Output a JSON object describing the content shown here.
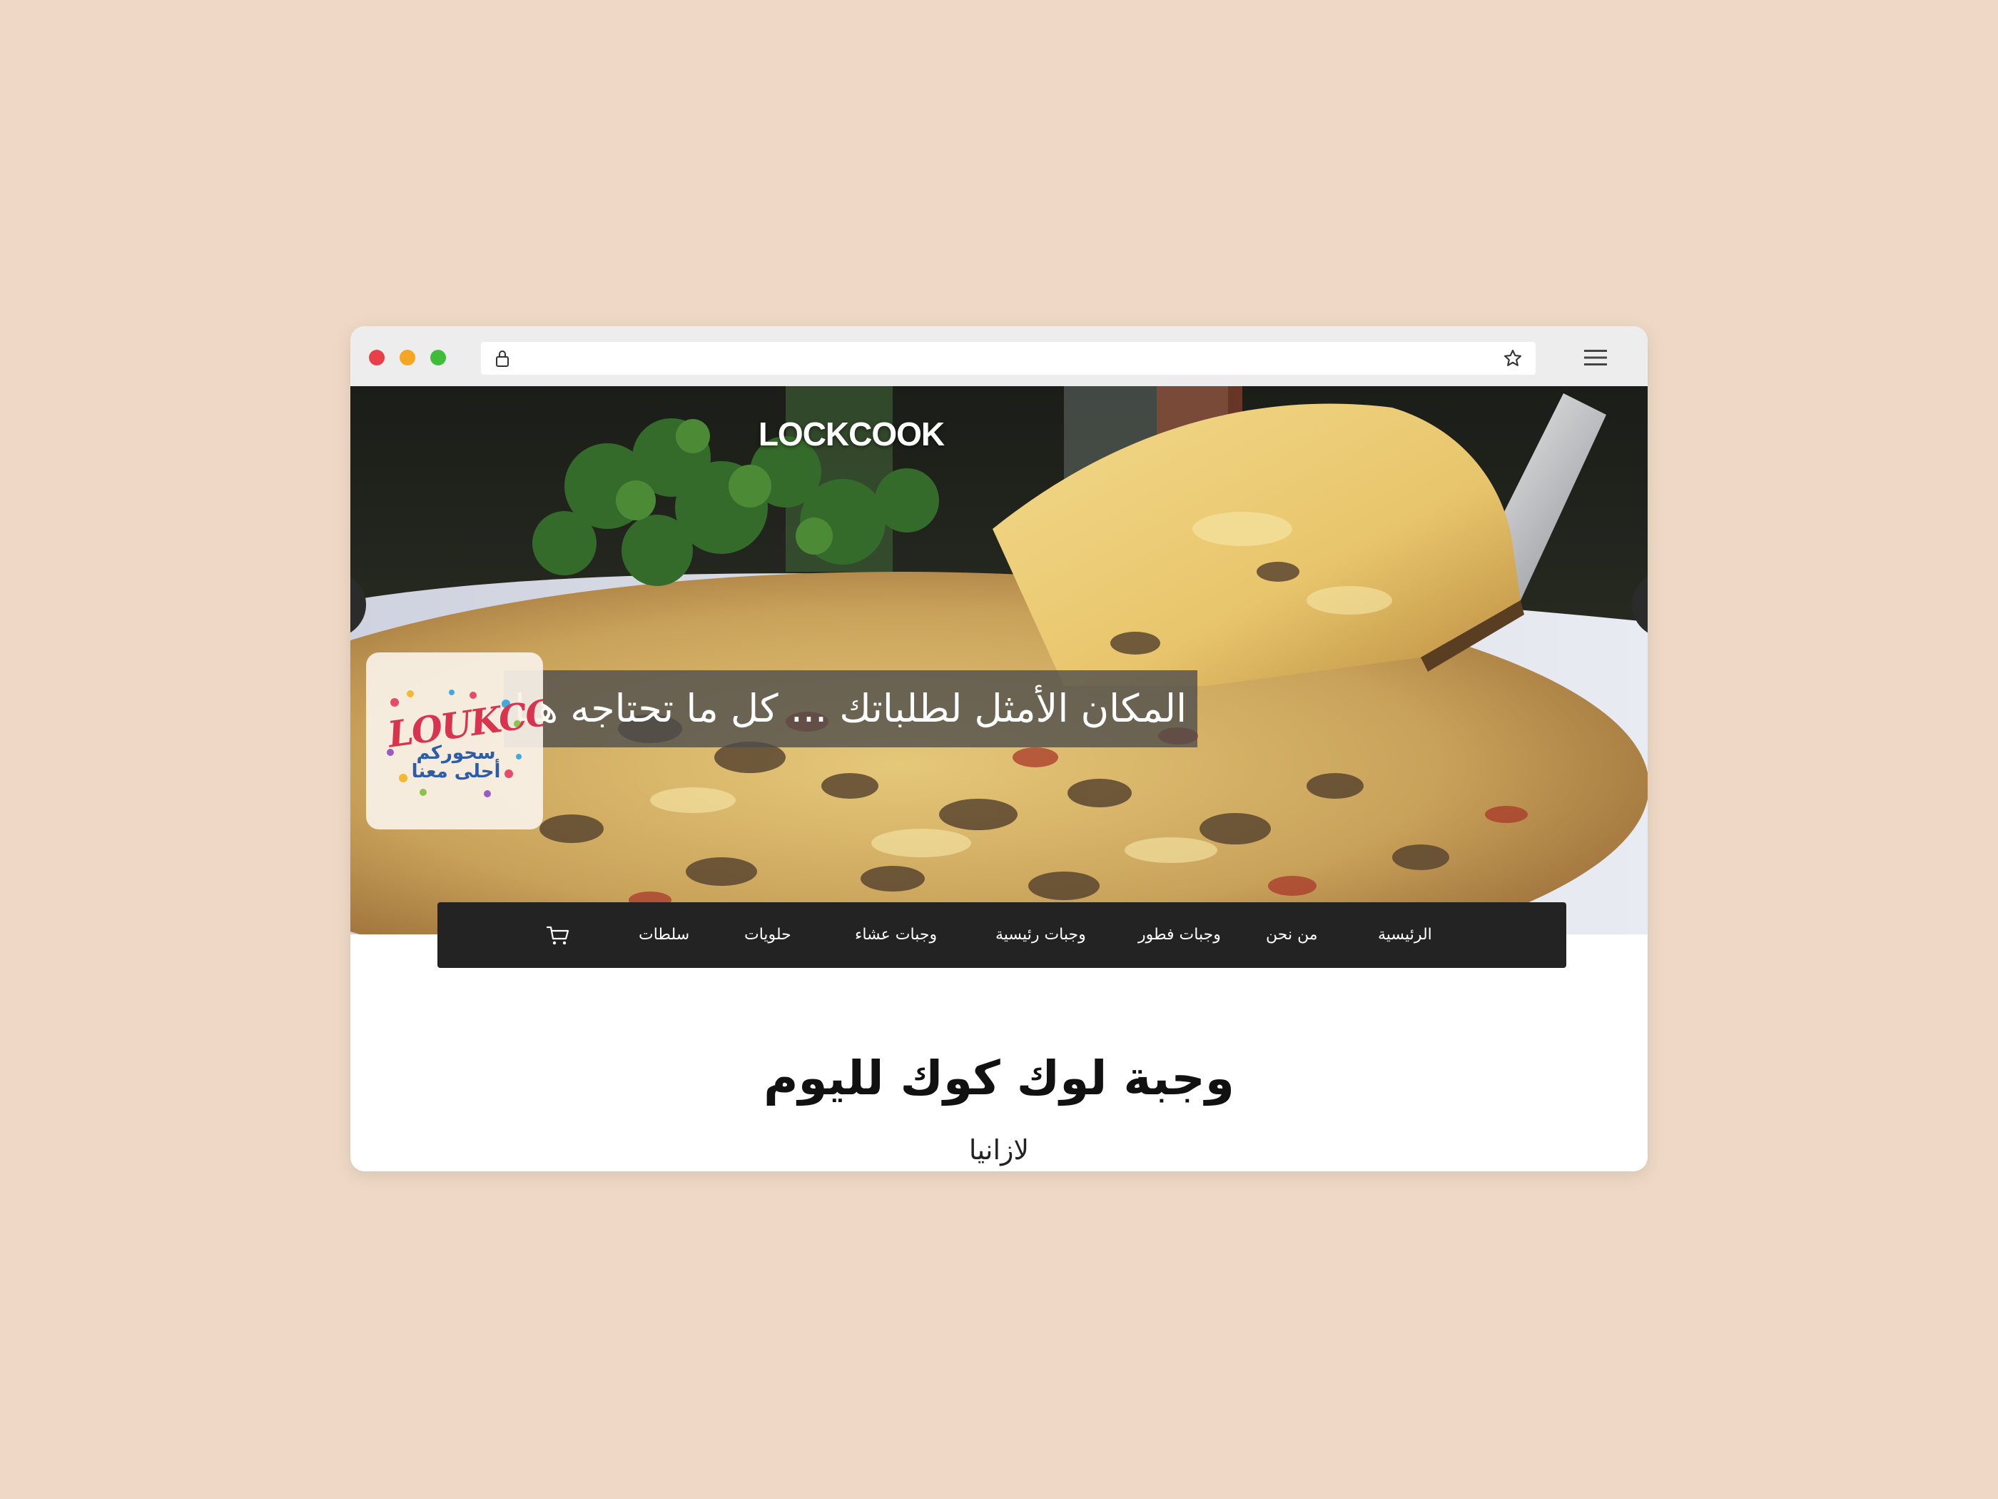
{
  "browser": {
    "address": "",
    "icons": [
      "lock-icon",
      "star-icon",
      "menu-icon"
    ]
  },
  "hero": {
    "brand": "LOCKCOOK",
    "tagline": "المكان الأمثل لطلباتك ... كل ما تحتاجه هنا",
    "logo": {
      "wordmark": "LOUKCOOK",
      "slogan_line1": "سحوركم",
      "slogan_line2": "أحلى معنا"
    }
  },
  "nav": {
    "items": [
      {
        "label": "الرئيسية"
      },
      {
        "label": "من نحن"
      },
      {
        "label": "وجبات فطور"
      },
      {
        "label": "وجبات رئيسية"
      },
      {
        "label": "وجبات عشاء"
      },
      {
        "label": "حلويات"
      },
      {
        "label": "سلطات"
      }
    ],
    "cart_icon": "cart-icon"
  },
  "main": {
    "heading": "وجبة لوك كوك لليوم",
    "dish": "لازانيا"
  },
  "colors": {
    "page_background": "#efd9c6",
    "nav_background": "#232323",
    "traffic_red": "#e8404b",
    "traffic_yellow": "#f5a623",
    "traffic_green": "#3fbd3a"
  }
}
